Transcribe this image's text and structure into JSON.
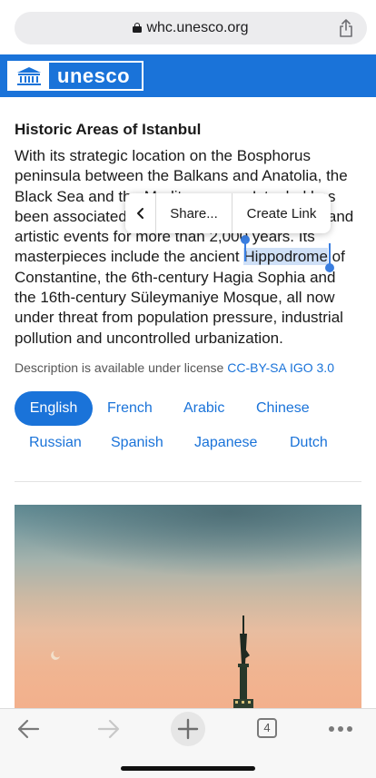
{
  "browser": {
    "url": "whc.unesco.org",
    "tab_count": "4"
  },
  "brand": {
    "logo_text": "unesco"
  },
  "article": {
    "title": "Historic Areas of Istanbul",
    "lines": [
      "With its strategic location on the Bosphorus",
      "peninsula between the Balkans and Anatolia, the",
      "Black Sea and the Mediterranean, Istanbul has",
      "been associated with major political, religious and",
      "artistic events for more than 2,000 years. Its",
      "masterpieces include the ancient ",
      "Hippodrome",
      " of",
      "Constantine, the 6th-century Hagia Sophia and",
      "the 16th-century Süleymaniye Mosque, all now",
      "under threat from population pressure, industrial",
      "pollution and uncontrolled urbanization."
    ],
    "license_prefix": "Description is available under license ",
    "license_link": "CC-BY-SA IGO 3.0"
  },
  "context_menu": {
    "back": "<",
    "share": "Share...",
    "create_link": "Create Link"
  },
  "languages": {
    "active": "English",
    "others": [
      "French",
      "Arabic",
      "Chinese",
      "Russian",
      "Spanish",
      "Japanese",
      "Dutch"
    ]
  },
  "colors": {
    "brand_blue": "#1a73d9",
    "selection": "#cfe0f7"
  }
}
